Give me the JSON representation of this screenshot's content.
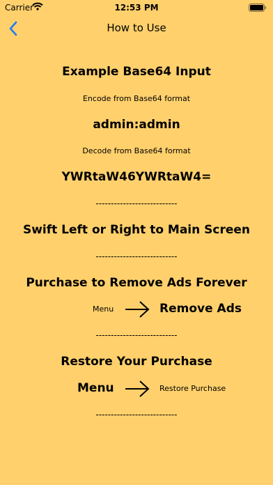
{
  "status_bar": {
    "carrier": "Carrier",
    "time": "12:53 PM"
  },
  "nav": {
    "title": "How to Use"
  },
  "content": {
    "example_heading": "Example Base64 Input",
    "encode_caption": "Encode from Base64 format",
    "encode_value": "admin:admin",
    "decode_caption": "Decode from Base64 format",
    "decode_value": "YWRtaW46YWRtaW4=",
    "separator": "---------------------------",
    "swipe_heading": "Swift Left or Right to Main Screen",
    "purchase_heading": "Purchase to Remove Ads Forever",
    "purchase_menu": "Menu",
    "purchase_target": "Remove Ads",
    "restore_heading": "Restore Your Purchase",
    "restore_menu": "Menu",
    "restore_target": "Restore Purchase"
  },
  "icons": {
    "wifi": "wifi-icon",
    "battery": "battery-icon",
    "back": "chevron-left-icon",
    "arrow": "arrow-right-icon"
  },
  "colors": {
    "background": "#FFD06C",
    "accent": "#1E7CF2"
  }
}
